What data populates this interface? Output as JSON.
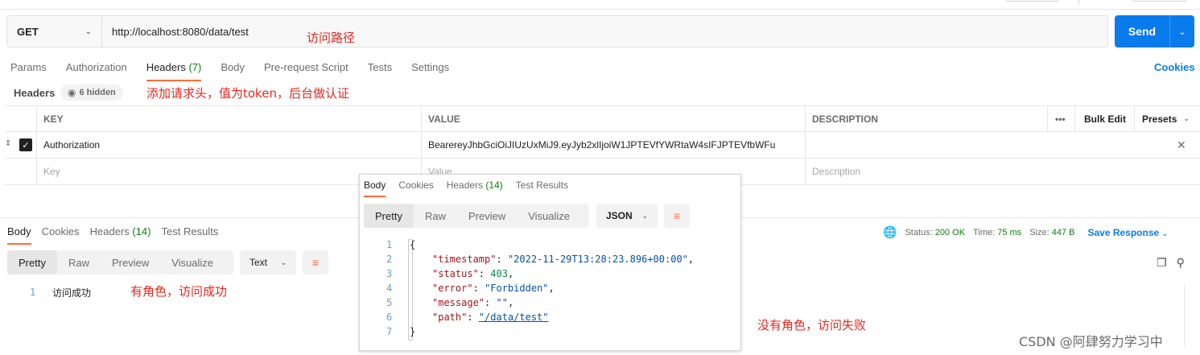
{
  "request": {
    "method": "GET",
    "url": "http://localhost:8080/data/test",
    "send_label": "Send"
  },
  "request_tabs": [
    {
      "label": "Params"
    },
    {
      "label": "Authorization"
    },
    {
      "label": "Headers",
      "count": "(7)"
    },
    {
      "label": "Body"
    },
    {
      "label": "Pre-request Script"
    },
    {
      "label": "Tests"
    },
    {
      "label": "Settings"
    }
  ],
  "cookies_label": "Cookies",
  "headers_section": {
    "label": "Headers",
    "hidden_label": "6 hidden"
  },
  "headers_table": {
    "columns": [
      "KEY",
      "VALUE",
      "DESCRIPTION"
    ],
    "bulk_edit": "Bulk Edit",
    "presets": "Presets",
    "more": "•••",
    "rows": [
      {
        "key": "Authorization",
        "value": "BearereyJhbGciOiJIUzUxMiJ9.eyJyb2xlIjoiW1JPTEVfYWRtaW4sIFJPTEVfbWFu",
        "description": ""
      }
    ],
    "placeholders": {
      "key": "Key",
      "value": "Value",
      "description": "Description"
    }
  },
  "response": {
    "tabs": [
      {
        "label": "Body"
      },
      {
        "label": "Cookies"
      },
      {
        "label": "Headers",
        "count": "(14)"
      },
      {
        "label": "Test Results"
      }
    ],
    "status_label": "Status:",
    "status_value": "200 OK",
    "time_label": "Time:",
    "time_value": "75 ms",
    "size_label": "Size:",
    "size_value": "447 B",
    "save_label": "Save Response",
    "formats": [
      "Pretty",
      "Raw",
      "Preview",
      "Visualize"
    ],
    "type": "Text",
    "lines": [
      {
        "no": "1",
        "text": "访问成功"
      }
    ]
  },
  "popup": {
    "tabs": [
      {
        "label": "Body"
      },
      {
        "label": "Cookies"
      },
      {
        "label": "Headers",
        "count": "(14)"
      },
      {
        "label": "Test Results"
      }
    ],
    "formats": [
      "Pretty",
      "Raw",
      "Preview",
      "Visualize"
    ],
    "type": "JSON",
    "line_numbers": [
      "1",
      "2",
      "3",
      "4",
      "5",
      "6",
      "7"
    ],
    "json": {
      "open": "{",
      "close": "}",
      "timestamp_key": "\"timestamp\"",
      "timestamp_value": "\"2022-11-29T13:28:23.896+00:00\"",
      "status_key": "\"status\"",
      "status_value": "403",
      "error_key": "\"error\"",
      "error_value": "\"Forbidden\"",
      "message_key": "\"message\"",
      "message_value": "\"\"",
      "path_key": "\"path\"",
      "path_value": "\"/data/test\""
    }
  },
  "annotations": {
    "url_note": "访问路径",
    "header_note": "添加请求头，值为token，后台做认证",
    "success_note": "有角色，访问成功",
    "fail_note": "没有角色，访问失败"
  },
  "watermark": "CSDN @阿肆努力学习中",
  "colors": {
    "accent": "#ff6c37",
    "send": "#097bed",
    "annotation": "#e8261c",
    "status_ok": "#0f7b0f"
  }
}
